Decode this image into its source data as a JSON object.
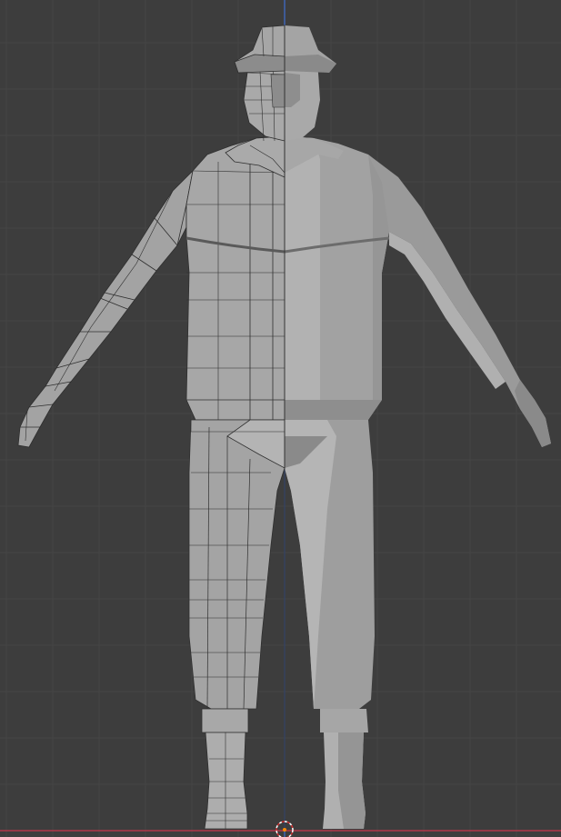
{
  "viewport": {
    "mode": "modeling",
    "view": "front-orthographic",
    "background_color": "#3d3d3d",
    "grid_minor_color": "#454545",
    "grid_major_color": "#4a4a4a",
    "z_axis_color": "#3f6fd1",
    "x_axis_color": "#c8374b",
    "show_grid": true,
    "show_wireframe_left_half": true
  },
  "model": {
    "name": "",
    "type": "mesh",
    "symmetry": "mirror-x",
    "shading": "solid",
    "left_half": "wireframe-overlay",
    "right_half": "solid-shaded",
    "parts": [
      "hat",
      "head",
      "torso",
      "arm-left",
      "arm-right",
      "hand-left",
      "hand-right",
      "pants",
      "leg-left",
      "leg-right",
      "boot-left",
      "boot-right"
    ]
  },
  "cursor": {
    "icon": "3d-cursor-icon"
  }
}
